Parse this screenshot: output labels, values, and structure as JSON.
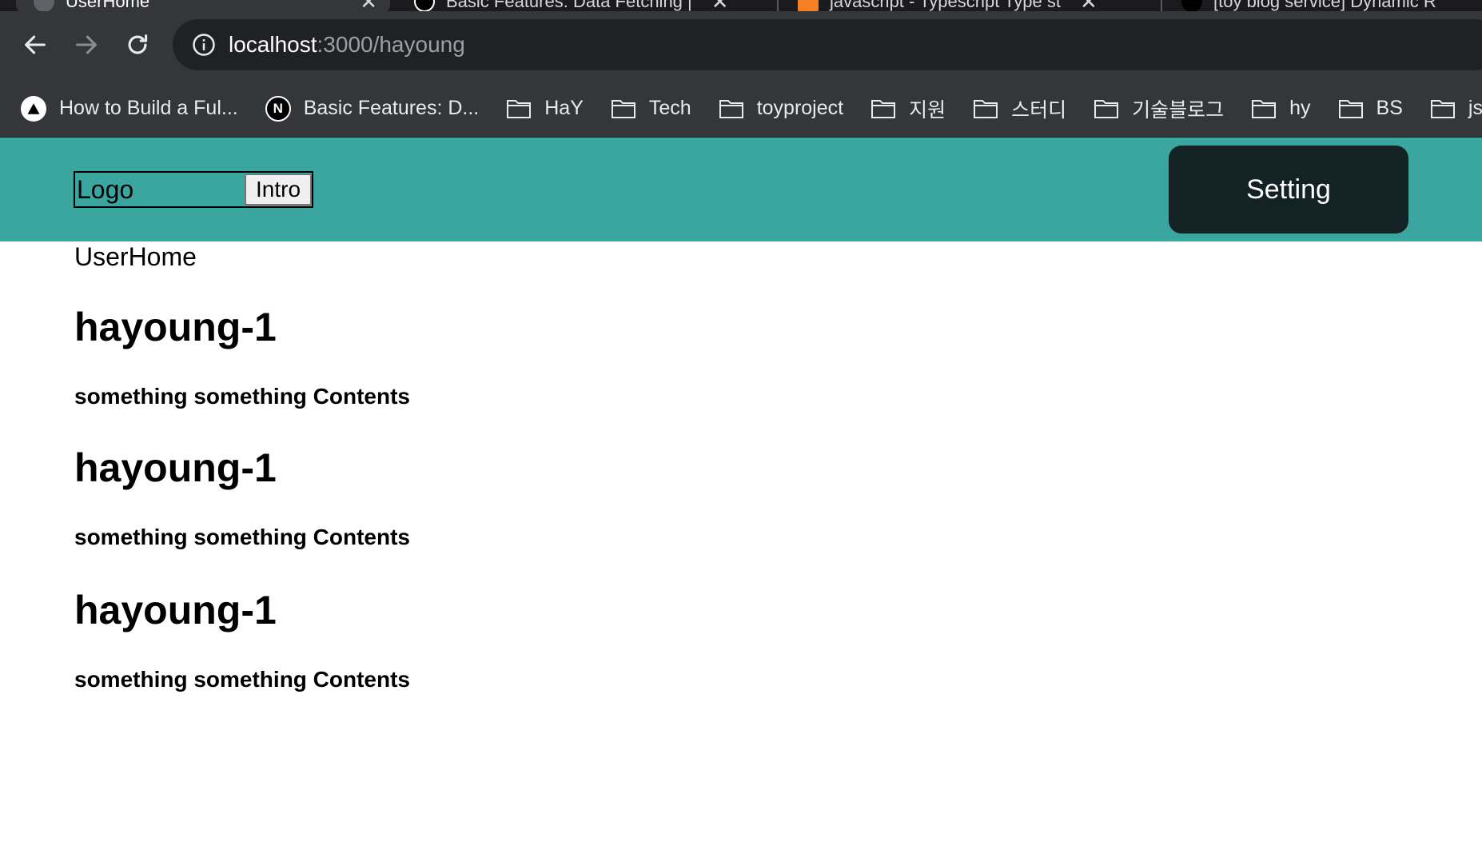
{
  "browser": {
    "tabs": [
      {
        "title": "UserHome",
        "active": true
      },
      {
        "title": "Basic Features: Data Fetching |",
        "active": false
      },
      {
        "title": "javascript - Typescript Type st",
        "active": false
      },
      {
        "title": "[toy blog service] Dynamic R",
        "active": false
      }
    ],
    "url_host": "localhost",
    "url_rest": ":3000/hayoung",
    "bookmarks": [
      {
        "label": "How to Build a Ful...",
        "icon": "triangle-logo-icon"
      },
      {
        "label": "Basic Features: D...",
        "icon": "nextjs-logo-icon"
      },
      {
        "label": "HaY",
        "icon": "folder-icon"
      },
      {
        "label": "Tech",
        "icon": "folder-icon"
      },
      {
        "label": "toyproject",
        "icon": "folder-icon"
      },
      {
        "label": "지원",
        "icon": "folder-icon"
      },
      {
        "label": "스터디",
        "icon": "folder-icon"
      },
      {
        "label": "기술블로그",
        "icon": "folder-icon"
      },
      {
        "label": "hy",
        "icon": "folder-icon"
      },
      {
        "label": "BS",
        "icon": "folder-icon"
      },
      {
        "label": "js-c",
        "icon": "folder-icon"
      }
    ]
  },
  "header": {
    "logo": "Logo",
    "intro_label": "Intro",
    "setting_label": "Setting"
  },
  "page": {
    "label": "UserHome",
    "posts": [
      {
        "title": "hayoung-1",
        "body": "something something Contents"
      },
      {
        "title": "hayoung-1",
        "body": "something something Contents"
      },
      {
        "title": "hayoung-1",
        "body": "something something Contents"
      }
    ]
  },
  "colors": {
    "header_bg": "#3ba59f",
    "setting_bg": "#132224",
    "chrome_bg": "#35363a",
    "omnibox_bg": "#202124"
  }
}
